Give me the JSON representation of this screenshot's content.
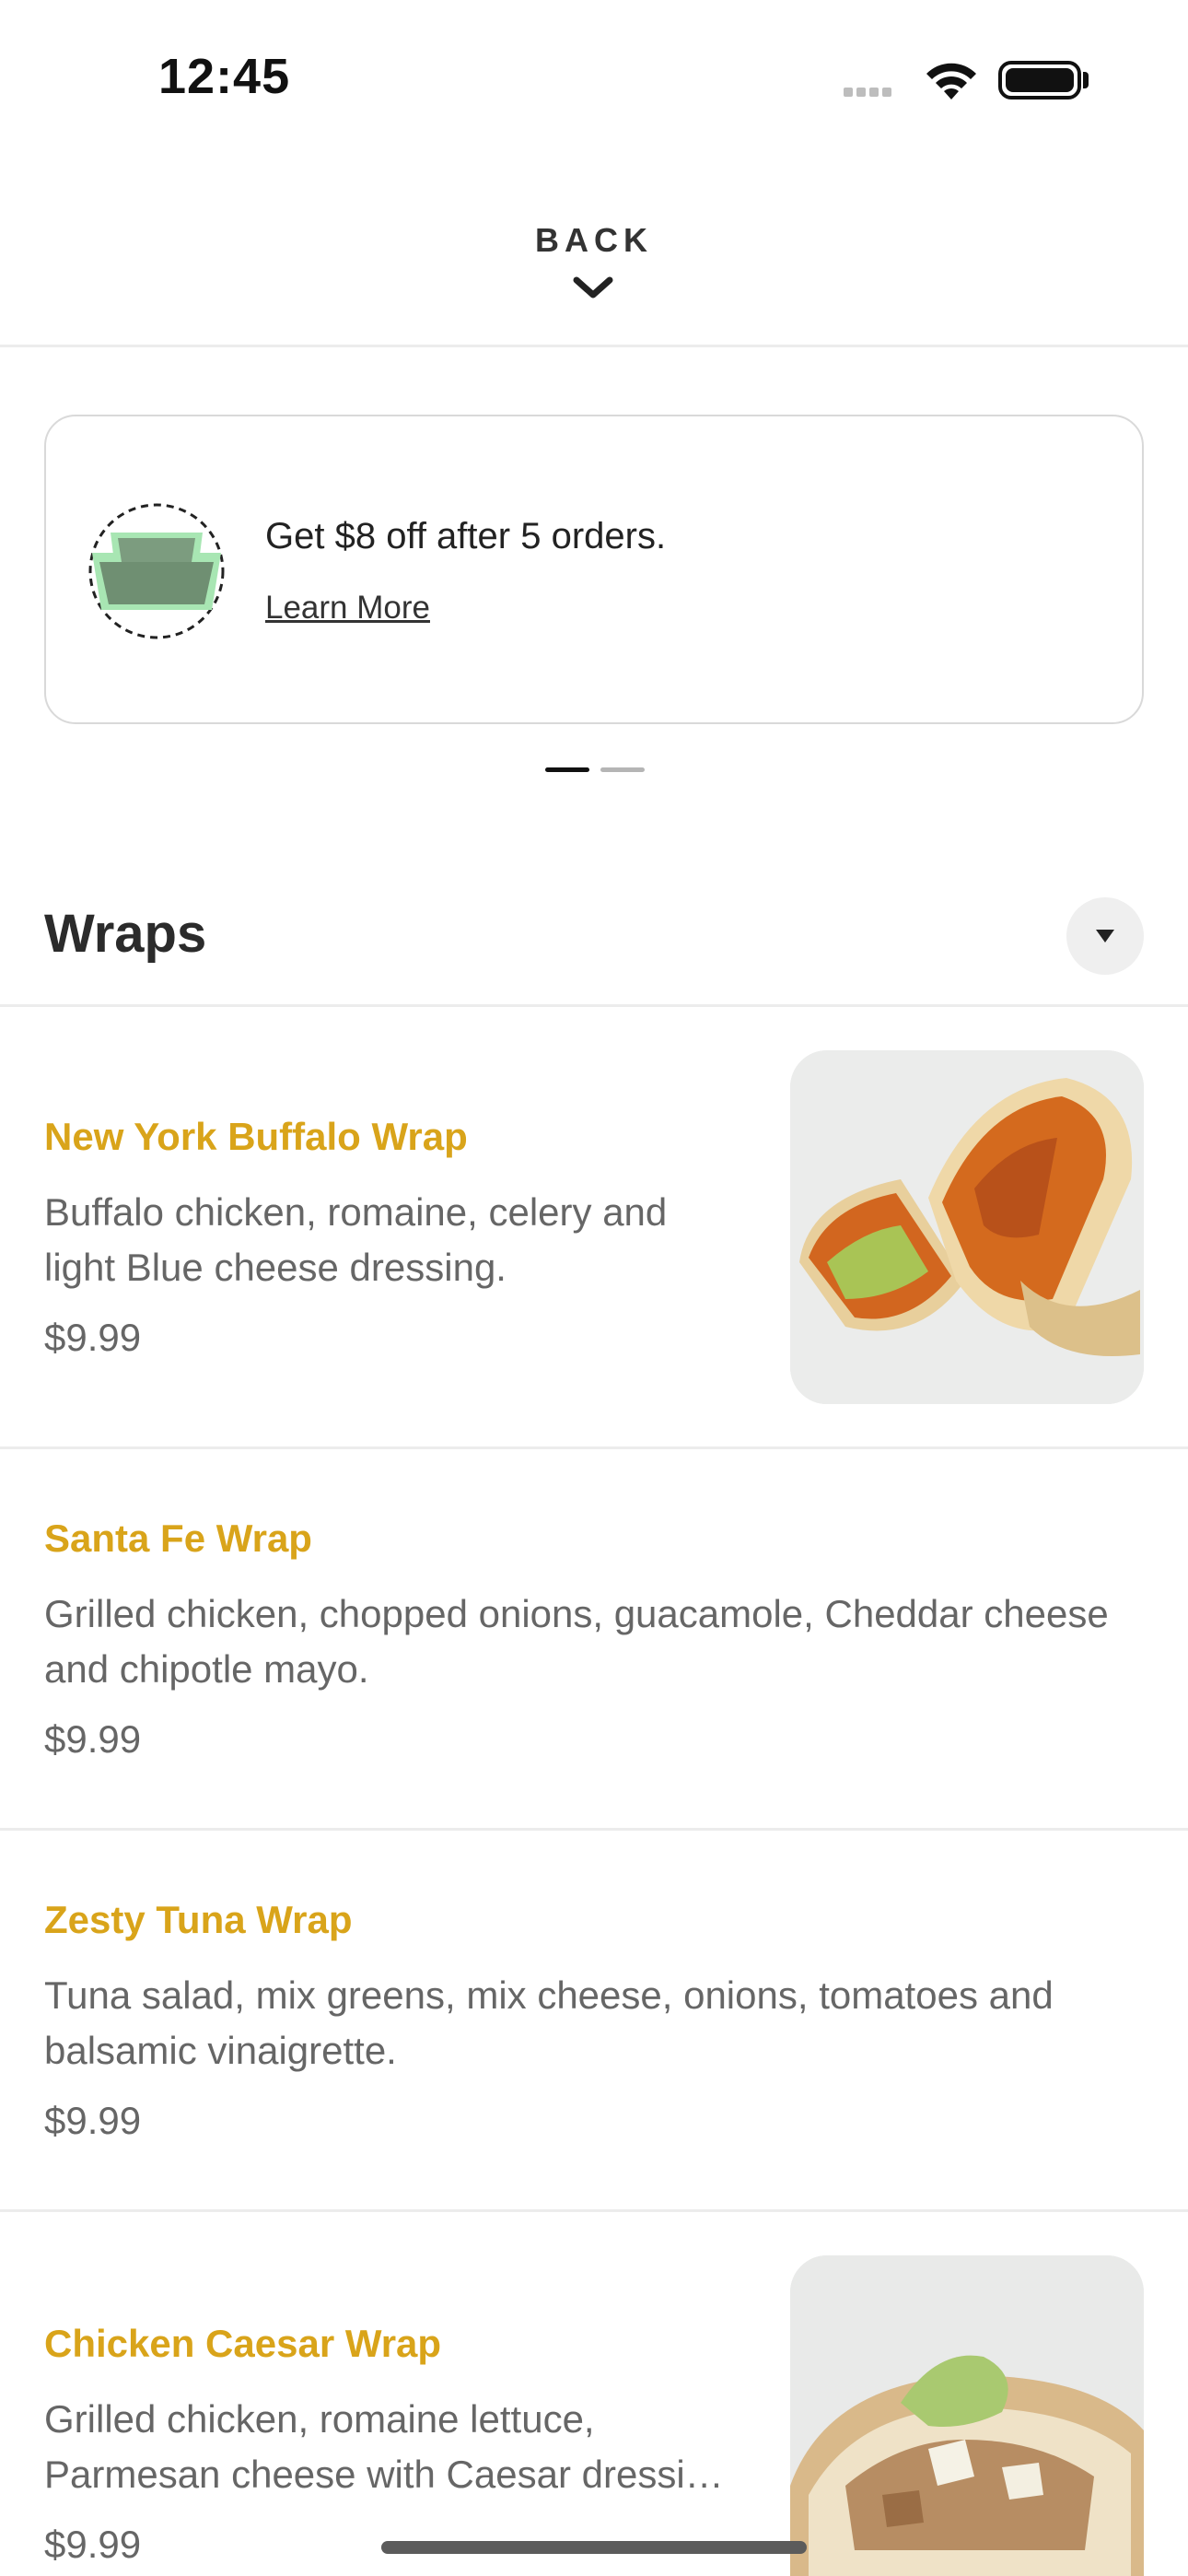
{
  "status": {
    "time": "12:45"
  },
  "header": {
    "back_label": "BACK"
  },
  "promo": {
    "text": "Get $8 off after 5 orders.",
    "link": "Learn More",
    "accent": "#a8e6b3"
  },
  "section": {
    "title": "Wraps"
  },
  "items": [
    {
      "name": "New York Buffalo Wrap",
      "desc": "Buffalo chicken, romaine, celery and light Blue cheese dressing.",
      "price": "$9.99"
    },
    {
      "name": "Santa Fe Wrap",
      "desc": "Grilled chicken, chopped onions, guacamole, Cheddar cheese and chipotle mayo.",
      "price": "$9.99"
    },
    {
      "name": "Zesty Tuna Wrap",
      "desc": "Tuna salad, mix greens, mix cheese, onions, tomatoes and balsamic vinaigrette.",
      "price": "$9.99"
    },
    {
      "name": "Chicken Caesar Wrap",
      "desc": "Grilled chicken, romaine lettuce, Parmesan cheese with Caesar dressi…",
      "price": "$9.99"
    }
  ],
  "colors": {
    "item_name": "#d9a41a",
    "divider": "#ececec"
  }
}
